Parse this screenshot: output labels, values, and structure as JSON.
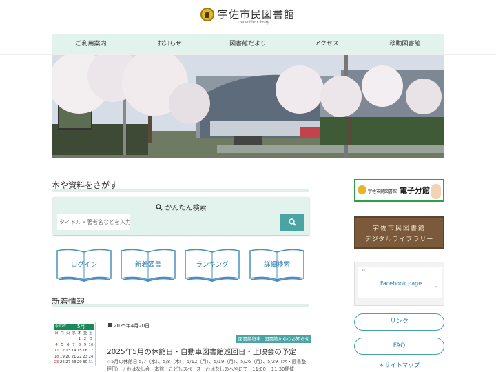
{
  "header": {
    "title": "宇佐市民図書館",
    "subtitle": "Usa Public Library"
  },
  "nav": [
    "ご利用案内",
    "お知らせ",
    "図書館だより",
    "アクセス",
    "移動図書館"
  ],
  "search_section": {
    "title": "本や資料をさがす",
    "box_title": "かんたん検索",
    "placeholder": "タイトル・著者名などを入力"
  },
  "book_buttons": [
    "ログイン",
    "新着図書",
    "ランキング",
    "詳細検索"
  ],
  "news_section": {
    "title": "新着情報"
  },
  "news_item": {
    "date": "2025年4月20日",
    "tags": [
      "図書館行事",
      "図書館からのお知らせ"
    ],
    "title": "2025年5月の休館日・自動車図書館巡回日・上映会の予定",
    "text": "☆5月の休館日 5/7（水）、5/8（木）、5/12（月）、5/19（月）、5/26（月）、5/29（木・図書整理日） ☆おはなし会　本館　こどもスペース　おはなしのへやにて　11:00~ 11:30開催"
  },
  "calendar": {
    "tag": "令和7年",
    "month": "5月",
    "weekdays": [
      "日",
      "月",
      "火",
      "水",
      "木",
      "金",
      "土"
    ],
    "rows": [
      [
        "",
        "",
        "",
        "",
        "1",
        "2",
        "3"
      ],
      [
        "4",
        "5",
        "6",
        "7",
        "8",
        "9",
        "10"
      ],
      [
        "11",
        "12",
        "13",
        "14",
        "15",
        "16",
        "17"
      ],
      [
        "18",
        "19",
        "20",
        "21",
        "22",
        "23",
        "24"
      ],
      [
        "25",
        "26",
        "27",
        "28",
        "29",
        "30",
        "31"
      ]
    ]
  },
  "sidebar": {
    "banner1_text": "宇佐市民図書館",
    "banner1_big": "電子分館",
    "banner2_line1": "宇佐市民図書館",
    "banner2_line2": "デジタルライブラリー",
    "facebook": "Facebook page",
    "link": "リンク",
    "faq": "FAQ",
    "sitemap": "＊サイトマップ"
  },
  "colors": {
    "accent": "#4aa4a4",
    "nav_bg": "#e1f3ec",
    "link": "#2e7fb0",
    "brown": "#7a5a3a"
  }
}
